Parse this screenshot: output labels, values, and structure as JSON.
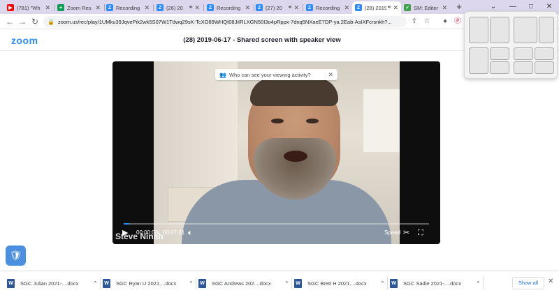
{
  "browser": {
    "tabs": [
      {
        "label": "(781) \"Wh",
        "favicon": "youtube-icon",
        "color": "#ff0000",
        "glyph": "▶",
        "active": false,
        "audio": false
      },
      {
        "label": "Zoom Res",
        "favicon": "sheets-icon",
        "color": "#0f9d58",
        "glyph": "+",
        "active": false,
        "audio": false
      },
      {
        "label": "Recording",
        "favicon": "zoom-icon",
        "color": "#2d8cff",
        "glyph": "Z",
        "active": false,
        "audio": false
      },
      {
        "label": "(26) 20",
        "favicon": "zoom-icon",
        "color": "#2d8cff",
        "glyph": "Z",
        "active": false,
        "audio": true
      },
      {
        "label": "Recording",
        "favicon": "zoom-icon",
        "color": "#2d8cff",
        "glyph": "Z",
        "active": false,
        "audio": false
      },
      {
        "label": "(27) 20",
        "favicon": "zoom-icon",
        "color": "#2d8cff",
        "glyph": "Z",
        "active": false,
        "audio": true
      },
      {
        "label": "Recording",
        "favicon": "zoom-icon",
        "color": "#2d8cff",
        "glyph": "Z",
        "active": false,
        "audio": false
      },
      {
        "label": "(28) 2019-",
        "favicon": "zoom-icon",
        "color": "#2d8cff",
        "glyph": "Z",
        "active": true,
        "audio": true
      },
      {
        "label": "SM: Editor",
        "favicon": "shield-icon",
        "color": "#3fa34d",
        "glyph": "✓",
        "active": false,
        "audio": false
      }
    ],
    "newtab_label": "+",
    "url": "zoom.us/rec/play/1UMku39JqvePik2wk5S07W1Tdwq29sK-TcXO89WHQt08JiIRLXGN50I3o4pRppx-7dnq5NXaeE7DP-ya.2Eab-AsIXFcrsnkh?...",
    "window_controls": {
      "menu": "⌄",
      "minimize": "—",
      "maximize": "□",
      "close": "✕"
    }
  },
  "page": {
    "logo": "zoom",
    "title": "(28) 2019-06-17 - Shared screen with speaker view"
  },
  "player": {
    "privacy_prompt": "Who can see your viewing activity?",
    "speaker_name": "Steve Ninah",
    "current_time": "00:00:08",
    "time_separator": "/",
    "duration": "00:07:21",
    "progress_fraction": 0.019,
    "speed_label": "Speed"
  },
  "downloads": {
    "items": [
      {
        "name": "SGC Julian 2021-....docx"
      },
      {
        "name": "SGC Ryan U 2021....docx"
      },
      {
        "name": "SGC Andreas 202....docx"
      },
      {
        "name": "SGC Brett H 2021....docx"
      },
      {
        "name": "SGC Sadie 2021-....docx"
      }
    ],
    "show_all": "Show all"
  },
  "colors": {
    "accent": "#2d8cff",
    "tabstrip": "#dcd7ec",
    "word_blue": "#2b579a"
  }
}
